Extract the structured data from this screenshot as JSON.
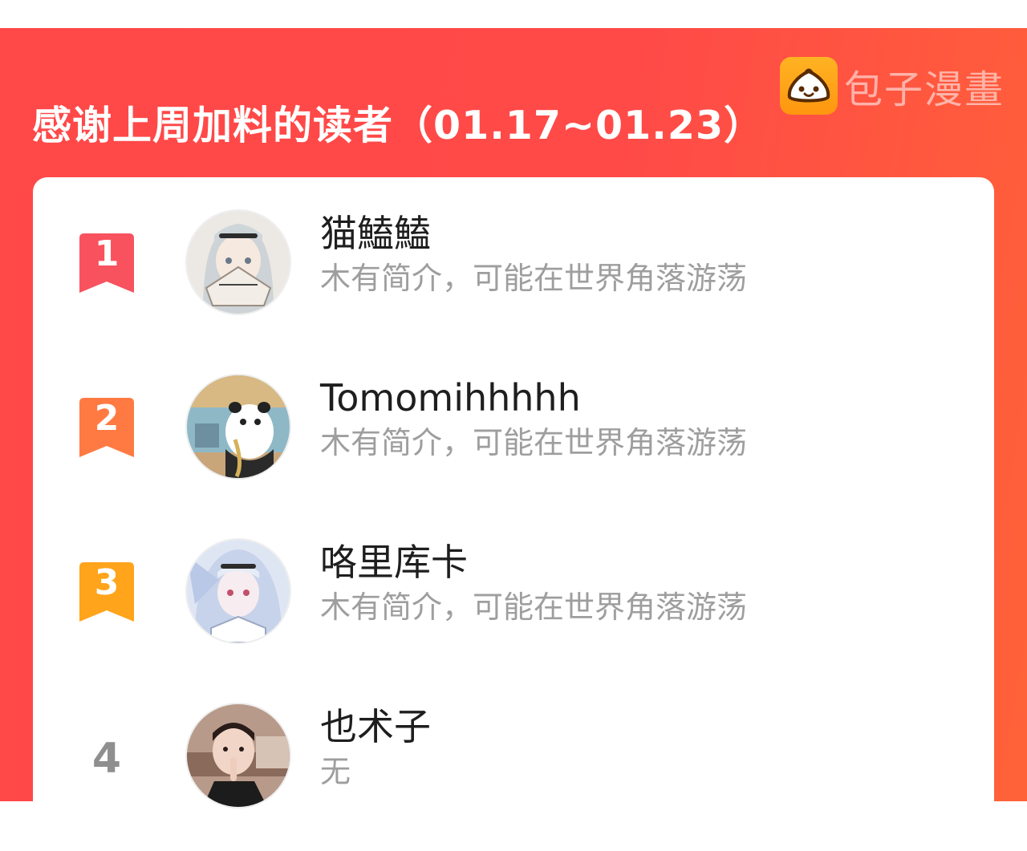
{
  "header": {
    "title": "感谢上周加料的读者（01.17~01.23）",
    "brand_text": "包子漫畫",
    "brand_icon": "bun-icon"
  },
  "colors": {
    "banner": "#ff4848",
    "rank1": "#f8525e",
    "rank2": "#ff7a43",
    "rank3": "#ffa41b",
    "rank_plain": "#8f8f8f",
    "logo": "#ffa41b"
  },
  "readers": [
    {
      "rank": "1",
      "name": "猫鰪鰪",
      "bio": "木有简介，可能在世界角落游荡"
    },
    {
      "rank": "2",
      "name": "Tomomihhhhh",
      "bio": "木有简介，可能在世界角落游荡"
    },
    {
      "rank": "3",
      "name": "咯里库卡",
      "bio": "木有简介，可能在世界角落游荡"
    },
    {
      "rank": "4",
      "name": "也术子",
      "bio": "无"
    }
  ]
}
